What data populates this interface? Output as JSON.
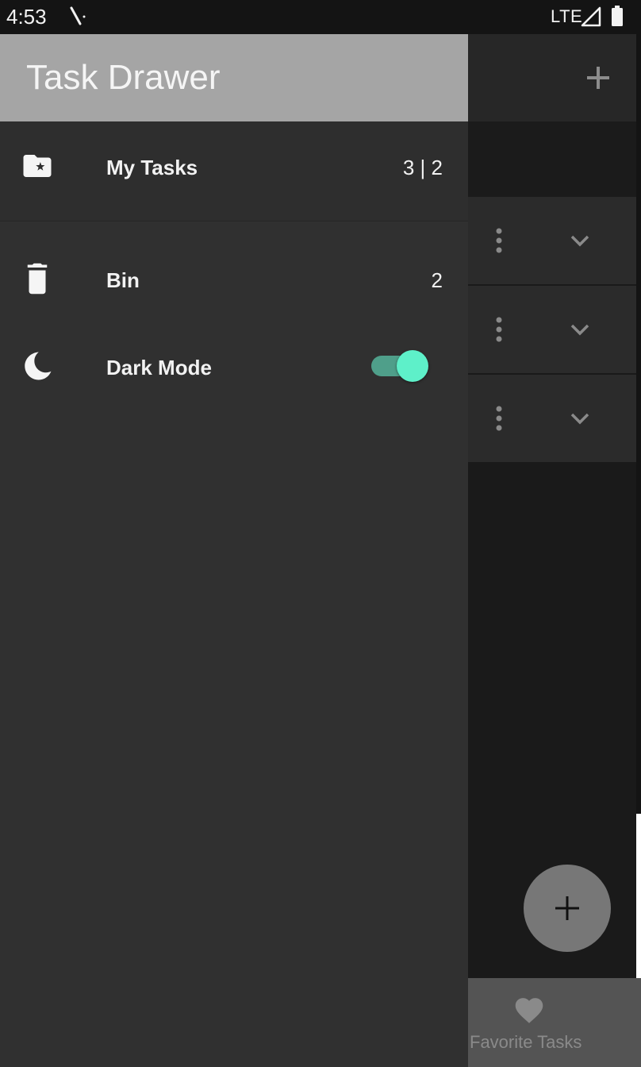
{
  "status_bar": {
    "time": "4:53",
    "network": "LTE"
  },
  "drawer": {
    "title": "Task Drawer",
    "items": [
      {
        "label": "My Tasks",
        "count": "3 | 2",
        "icon": "folder-star-icon"
      },
      {
        "label": "Bin",
        "count": "2",
        "icon": "trash-icon"
      },
      {
        "label": "Dark Mode",
        "icon": "moon-icon",
        "toggle_on": true
      }
    ]
  },
  "background_app": {
    "bottom_nav": {
      "label": "Favorite Tasks",
      "icon": "heart-icon"
    }
  },
  "colors": {
    "accent_toggle": "#5ef0c9",
    "drawer_bg": "#303030",
    "header_bg": "#a5a5a5"
  }
}
